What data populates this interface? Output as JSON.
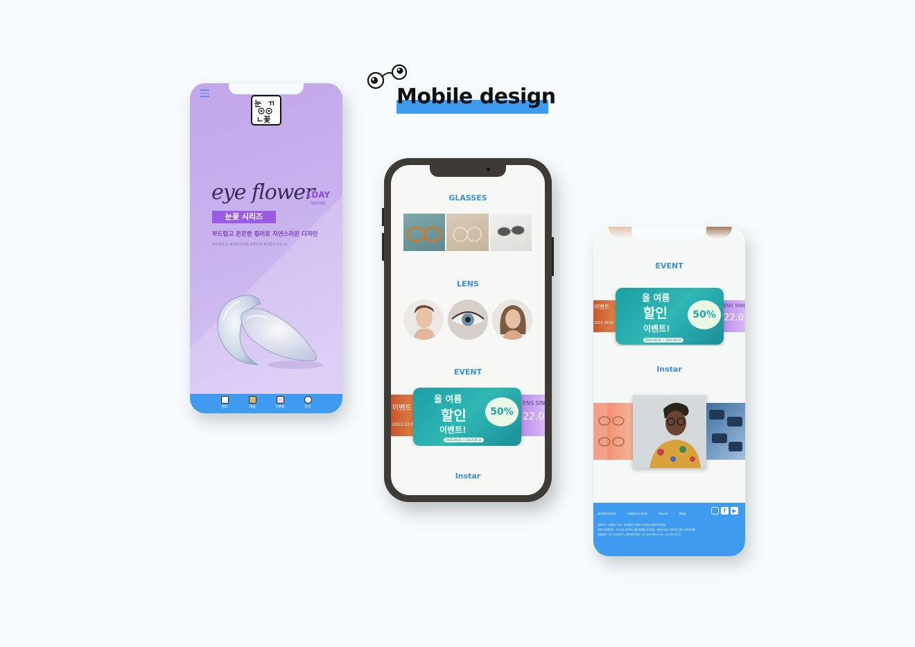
{
  "heading": {
    "title": "Mobile design"
  },
  "phone1": {
    "brand_logo_text": "눈꽃",
    "product_name": "eye flower",
    "oneday": "1DAY",
    "series": "Series",
    "badge": "눈꽃 시리즈",
    "description": "부드럽고 은은한 컬러로 자연스러운 디자인",
    "tags": "#또렷한 눈 #자연스러움 #편안한 #데일리 #1+1",
    "tabs": [
      {
        "label": "렌즈",
        "icon": "home-icon"
      },
      {
        "label": "게움",
        "icon": "product-icon"
      },
      {
        "label": "이벤트",
        "icon": "event-icon"
      },
      {
        "label": "문의",
        "icon": "inquiry-icon"
      }
    ]
  },
  "phone2": {
    "glasses_title": "GLASSES",
    "lens_title": "LENS",
    "event_title": "EVENT",
    "instar_title": "Instar"
  },
  "event_banner": {
    "line1": "올 여름",
    "line2": "할인",
    "line3": "이벤트!",
    "percent": "50%",
    "period": "2022.08.01 ~ 2022.08.31",
    "left_date": "2022.10.01",
    "left_event": "이벤트",
    "right_text": "ENS SINC",
    "right_date": "22.0"
  },
  "phone3": {
    "event_title": "EVENT",
    "instar_title": "Instar",
    "footer_links": [
      "개인정보처리방침",
      "이메일무단수집거부",
      "회사소개",
      "멤버쉽"
    ],
    "footer_info_1": "대표이사 : 김현진 | 주소 : 부산광역시 금정구 구서동 눈꽃로123번길",
    "footer_info_2": "사업자 등록번호 : 123-45-67890 | 통신판매업 신고번호 : 제2019호 | 의료기기 광고 사전심의필",
    "footer_info_3": "대표전화 : 02-123-4567 | 전자우편 문의 : 02-456-7890 | Fax : 02-789-0123"
  },
  "colors": {
    "accent_blue": "#3e9bf0",
    "purple": "#9a5ce3",
    "teal": "#2fb7b4",
    "background": "#f5fbfc"
  }
}
